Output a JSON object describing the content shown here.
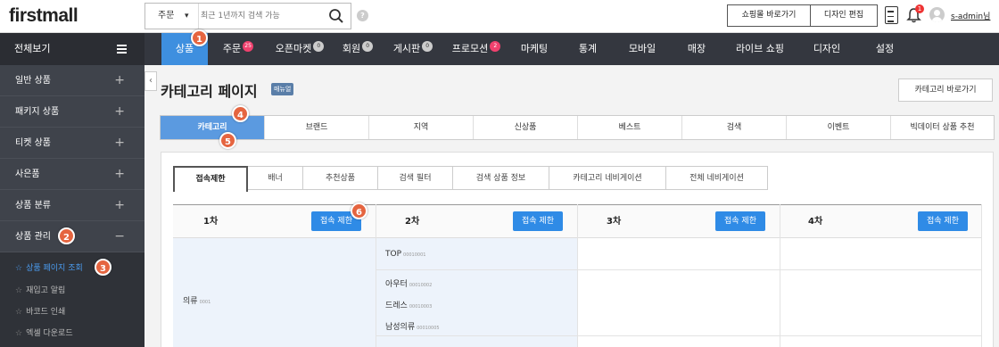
{
  "header": {
    "logo": "firstmall",
    "search_select": "주문",
    "search_placeholder": "최근 1년까지 검색 가능",
    "shop_button": "쇼핑몰 바로가기",
    "design_button": "디자인 편집",
    "notification_count": "1",
    "user": "s-admin님"
  },
  "nav": {
    "all_label": "전체보기",
    "items": [
      {
        "label": "상품",
        "badge": ""
      },
      {
        "label": "주문",
        "badge": "25"
      },
      {
        "label": "오픈마켓",
        "badge": "0"
      },
      {
        "label": "회원",
        "badge": "0"
      },
      {
        "label": "게시판",
        "badge": "0"
      },
      {
        "label": "프로모션",
        "badge": "2"
      },
      {
        "label": "마케팅",
        "badge": ""
      },
      {
        "label": "통계",
        "badge": ""
      },
      {
        "label": "모바일",
        "badge": ""
      },
      {
        "label": "매장",
        "badge": ""
      },
      {
        "label": "라이브 쇼핑",
        "badge": ""
      },
      {
        "label": "디자인",
        "badge": ""
      },
      {
        "label": "설정",
        "badge": ""
      }
    ]
  },
  "sidebar": {
    "items": [
      {
        "label": "일반 상품",
        "toggle": "+"
      },
      {
        "label": "패키지 상품",
        "toggle": "+"
      },
      {
        "label": "티켓 상품",
        "toggle": "+"
      },
      {
        "label": "사은품",
        "toggle": "+"
      },
      {
        "label": "상품 분류",
        "toggle": "+"
      },
      {
        "label": "상품 관리",
        "toggle": "−"
      }
    ],
    "sub_items": [
      {
        "label": "상품 페이지 조회"
      },
      {
        "label": "재입고 알림"
      },
      {
        "label": "바코드 인쇄"
      },
      {
        "label": "엑셀 다운로드"
      }
    ]
  },
  "page": {
    "title": "카테고리 페이지",
    "manual_badge": "매뉴얼",
    "category_go_button": "카테고리 바로가기"
  },
  "tabs1": [
    "카테고리",
    "브랜드",
    "지역",
    "신상품",
    "베스트",
    "검색",
    "이벤트",
    "빅데이터 상품 추천"
  ],
  "tabs2": [
    "접속제한",
    "배너",
    "추천상품",
    "검색 필터",
    "검색 상품 정보",
    "카테고리 네비게이션",
    "전체 네비게이션"
  ],
  "table": {
    "columns": [
      {
        "label": "1차",
        "button": "접속 제한"
      },
      {
        "label": "2차",
        "button": "접속 제한"
      },
      {
        "label": "3차",
        "button": "접속 제한"
      },
      {
        "label": "4차",
        "button": "접속 제한"
      }
    ],
    "level1": {
      "name": "의류",
      "code": "0001"
    },
    "level2": [
      {
        "name": "TOP",
        "code": "00010001"
      },
      {
        "name": "아우터",
        "code": "00010002"
      },
      {
        "name": "드레스",
        "code": "00010003"
      },
      {
        "name": "남성의류",
        "code": "00010005"
      }
    ]
  },
  "steps": [
    "1",
    "2",
    "3",
    "4",
    "5",
    "6"
  ]
}
